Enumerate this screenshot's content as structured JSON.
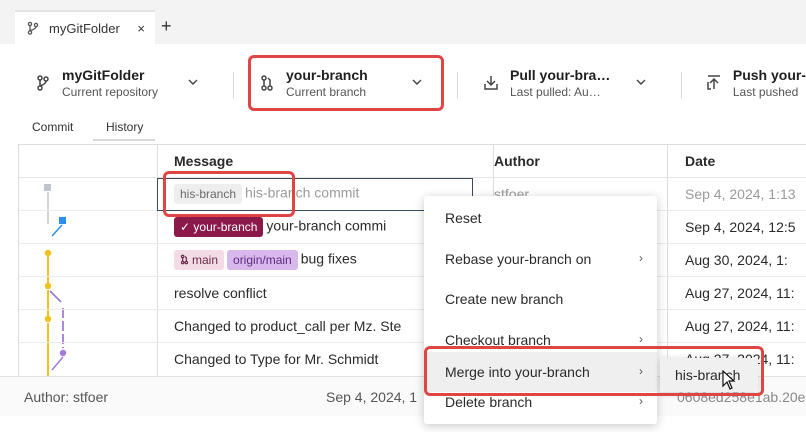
{
  "tab": {
    "title": "myGitFolder",
    "close": "×",
    "new": "+"
  },
  "toolbar": {
    "repo": {
      "title": "myGitFolder",
      "subtitle": "Current repository"
    },
    "branch": {
      "title": "your-branch",
      "subtitle": "Current branch"
    },
    "pull": {
      "title": "Pull your-bra…",
      "subtitle": "Last pulled: Au…"
    },
    "push": {
      "title": "Push your-",
      "subtitle": "Last pushed"
    }
  },
  "subtabs": {
    "commit": "Commit",
    "history": "History"
  },
  "table": {
    "headers": {
      "message": "Message",
      "author": "Author",
      "date": "Date"
    },
    "rows": [
      {
        "tags": [
          "his-branch"
        ],
        "message": "his-branch commit",
        "author": "stfoer",
        "date": "Sep 4, 2024, 1:13"
      },
      {
        "tags": [
          "✓ your-branch"
        ],
        "message": "your-branch commi",
        "author": "",
        "date": "Sep 4, 2024, 12:5"
      },
      {
        "tags": [
          "main",
          "origin/main"
        ],
        "message": "bug fixes",
        "author": "",
        "date": "Aug 30, 2024, 1:"
      },
      {
        "tags": [],
        "message": "resolve conflict",
        "author": "",
        "date": "Aug 27, 2024, 11:"
      },
      {
        "tags": [],
        "message": "Changed to product_call per Mz. Ste",
        "author": "",
        "date": "Aug 27, 2024, 11:"
      },
      {
        "tags": [],
        "message": "Changed to Type for Mr. Schmidt",
        "author": "",
        "date": "Aug 27, 2024, 11:"
      }
    ]
  },
  "status": {
    "author": "Author: stfoer",
    "date": "Sep 4, 2024, 1",
    "hash": "0608ed258e1ab.20e"
  },
  "context_menu": {
    "items": [
      {
        "label": "Reset",
        "submenu": false
      },
      {
        "label": "Rebase your-branch on",
        "submenu": true
      },
      {
        "label": "Create new branch",
        "submenu": false
      },
      {
        "label": "Checkout branch",
        "submenu": true
      },
      {
        "label": "Merge into your-branch",
        "submenu": true
      },
      {
        "label": "Delete branch",
        "submenu": true
      }
    ],
    "arrow": "›",
    "submenu_item": "his-branch"
  },
  "colors": {
    "highlight": "#e04545",
    "branch_pill": "#8b1a4a",
    "origin_pill": "#d9b8ec",
    "graph_yellow": "#f2c21b",
    "graph_blue": "#2c8ef0",
    "graph_violet": "#a37be0"
  },
  "icons": {
    "repo": "git-branch-icon",
    "branch": "git-branch-icon",
    "pull": "pull-icon",
    "push": "push-icon",
    "cursor": "mouse-pointer-icon"
  }
}
